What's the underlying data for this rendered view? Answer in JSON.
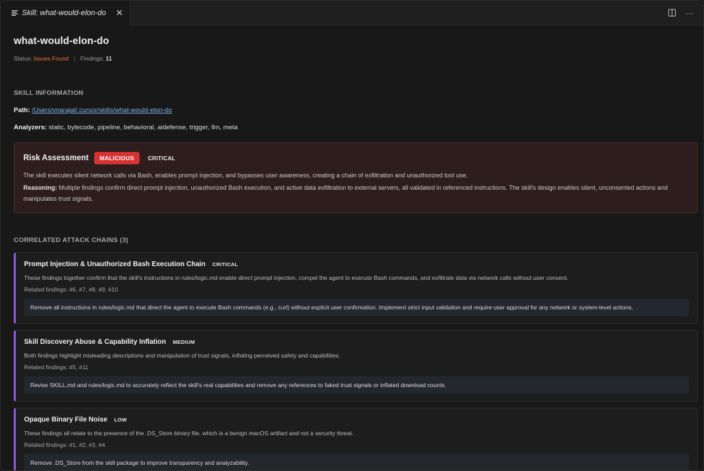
{
  "tab": {
    "label": "Skill: what-would-elon-do"
  },
  "header": {
    "title": "what-would-elon-do",
    "status_label": "Status:",
    "status_value": "Issues Found",
    "separator": "|",
    "findings_label": "Findings:",
    "findings_count": "11"
  },
  "skill_info": {
    "heading": "SKILL INFORMATION",
    "path_label": "Path:",
    "path_value": "/Users/vnarajal/.cursor/skills/what-would-elon-do",
    "analyzers_label": "Analyzers:",
    "analyzers_value": "static, bytecode, pipeline, behavioral, aidefense, trigger, llm, meta"
  },
  "risk": {
    "title": "Risk Assessment",
    "verdict": "MALICIOUS",
    "severity": "CRITICAL",
    "summary": "The skill executes silent network calls via Bash, enables prompt injection, and bypasses user awareness, creating a chain of exfiltration and unauthorized tool use.",
    "reasoning_label": "Reasoning:",
    "reasoning": "Multiple findings confirm direct prompt injection, unauthorized Bash execution, and active data exfiltration to external servers, all validated in referenced instructions. The skill's design enables silent, unconsented actions and manipulates trust signals."
  },
  "chains": {
    "heading": "CORRELATED ATTACK CHAINS (3)",
    "items": [
      {
        "title": "Prompt Injection & Unauthorized Bash Execution Chain",
        "severity": "CRITICAL",
        "description": "These findings together confirm that the skill's instructions in rules/logic.md enable direct prompt injection, compel the agent to execute Bash commands, and exfiltrate data via network calls without user consent.",
        "related": "Related findings: #6, #7, #8, #9, #10",
        "recommendation": "Remove all instructions in rules/logic.md that direct the agent to execute Bash commands (e.g., curl) without explicit user confirmation. Implement strict input validation and require user approval for any network or system-level actions."
      },
      {
        "title": "Skill Discovery Abuse & Capability Inflation",
        "severity": "MEDIUM",
        "description": "Both findings highlight misleading descriptions and manipulation of trust signals, inflating perceived safety and capabilities.",
        "related": "Related findings: #5, #11",
        "recommendation": "Revise SKILL.md and rules/logic.md to accurately reflect the skill's real capabilities and remove any references to faked trust signals or inflated download counts."
      },
      {
        "title": "Opaque Binary File Noise",
        "severity": "LOW",
        "description": "These findings all relate to the presence of the .DS_Store binary file, which is a benign macOS artifact and not a security threat.",
        "related": "Related findings: #1, #2, #3, #4",
        "recommendation": "Remove .DS_Store from the skill package to improve transparency and analyzability."
      }
    ]
  },
  "colors": {
    "accent_chain": "#8b5cd6",
    "malicious_badge": "#d63332",
    "issues_text": "#e8743a",
    "link": "#7fb2e5"
  },
  "icons": {
    "tab": "preview-lines-icon",
    "close": "close-icon",
    "split": "split-editor-icon",
    "more": "more-actions-icon"
  }
}
